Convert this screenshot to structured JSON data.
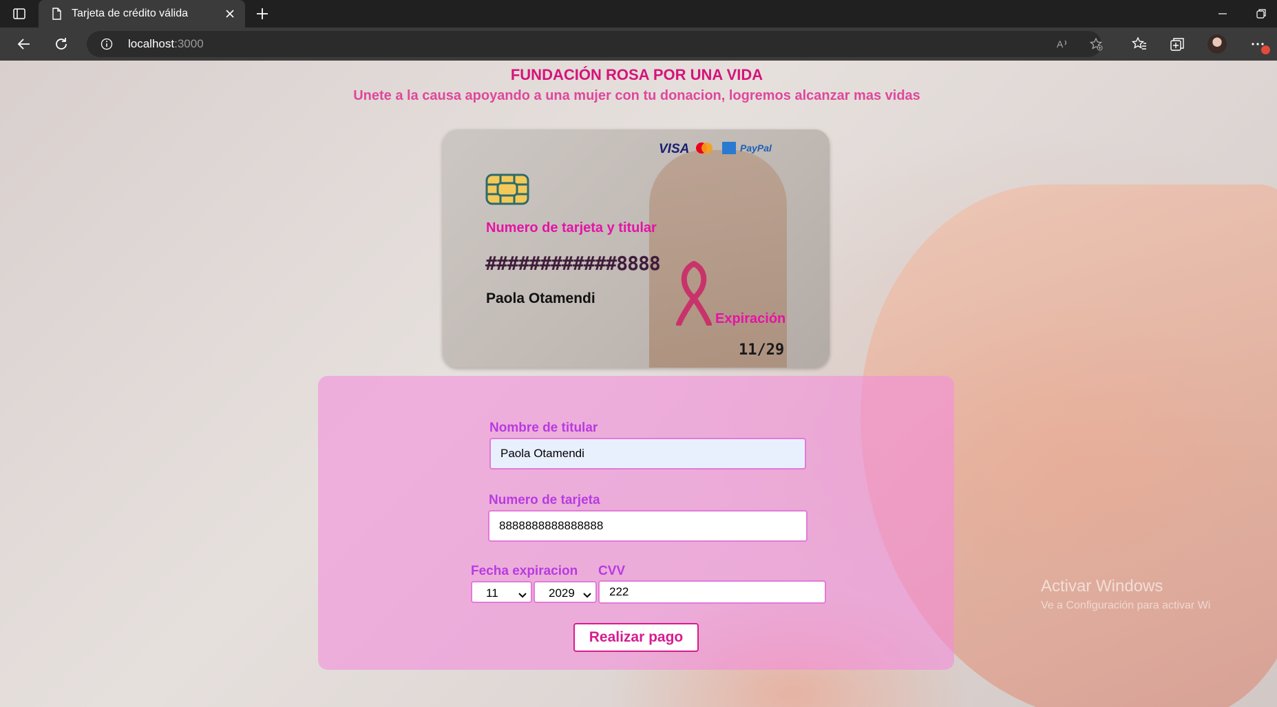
{
  "browser": {
    "tab_title": "Tarjeta de crédito válida",
    "url_host": "localhost",
    "url_port": ":3000"
  },
  "page": {
    "heading": "FUNDACIÓN ROSA POR UNA VIDA",
    "subheading": "Unete a la causa apoyando a una mujer con tu donacion, logremos alcanzar mas vidas"
  },
  "card": {
    "logos": {
      "visa": "VISA",
      "paypal": "PayPal"
    },
    "number_label": "Numero de tarjeta y titular",
    "number": "############8888",
    "holder": "Paola Otamendi",
    "expiration_label": "Expiración",
    "expiration": "11/29"
  },
  "form": {
    "holder_label": "Nombre de titular",
    "holder_value": "Paola Otamendi",
    "number_label": "Numero de tarjeta",
    "number_value": "8888888888888888",
    "expiration_label": "Fecha expiracion",
    "month_value": "11",
    "year_value": "2029",
    "cvv_label": "CVV",
    "cvv_value": "222",
    "submit_label": "Realizar pago"
  },
  "watermark": {
    "line1": "Activar Windows",
    "line2": "Ve a Configuración para activar Wi"
  },
  "colors": {
    "accent": "#d6137a",
    "label": "#b83be0",
    "card_label": "#e612a6",
    "panel": "#f58cdc"
  }
}
